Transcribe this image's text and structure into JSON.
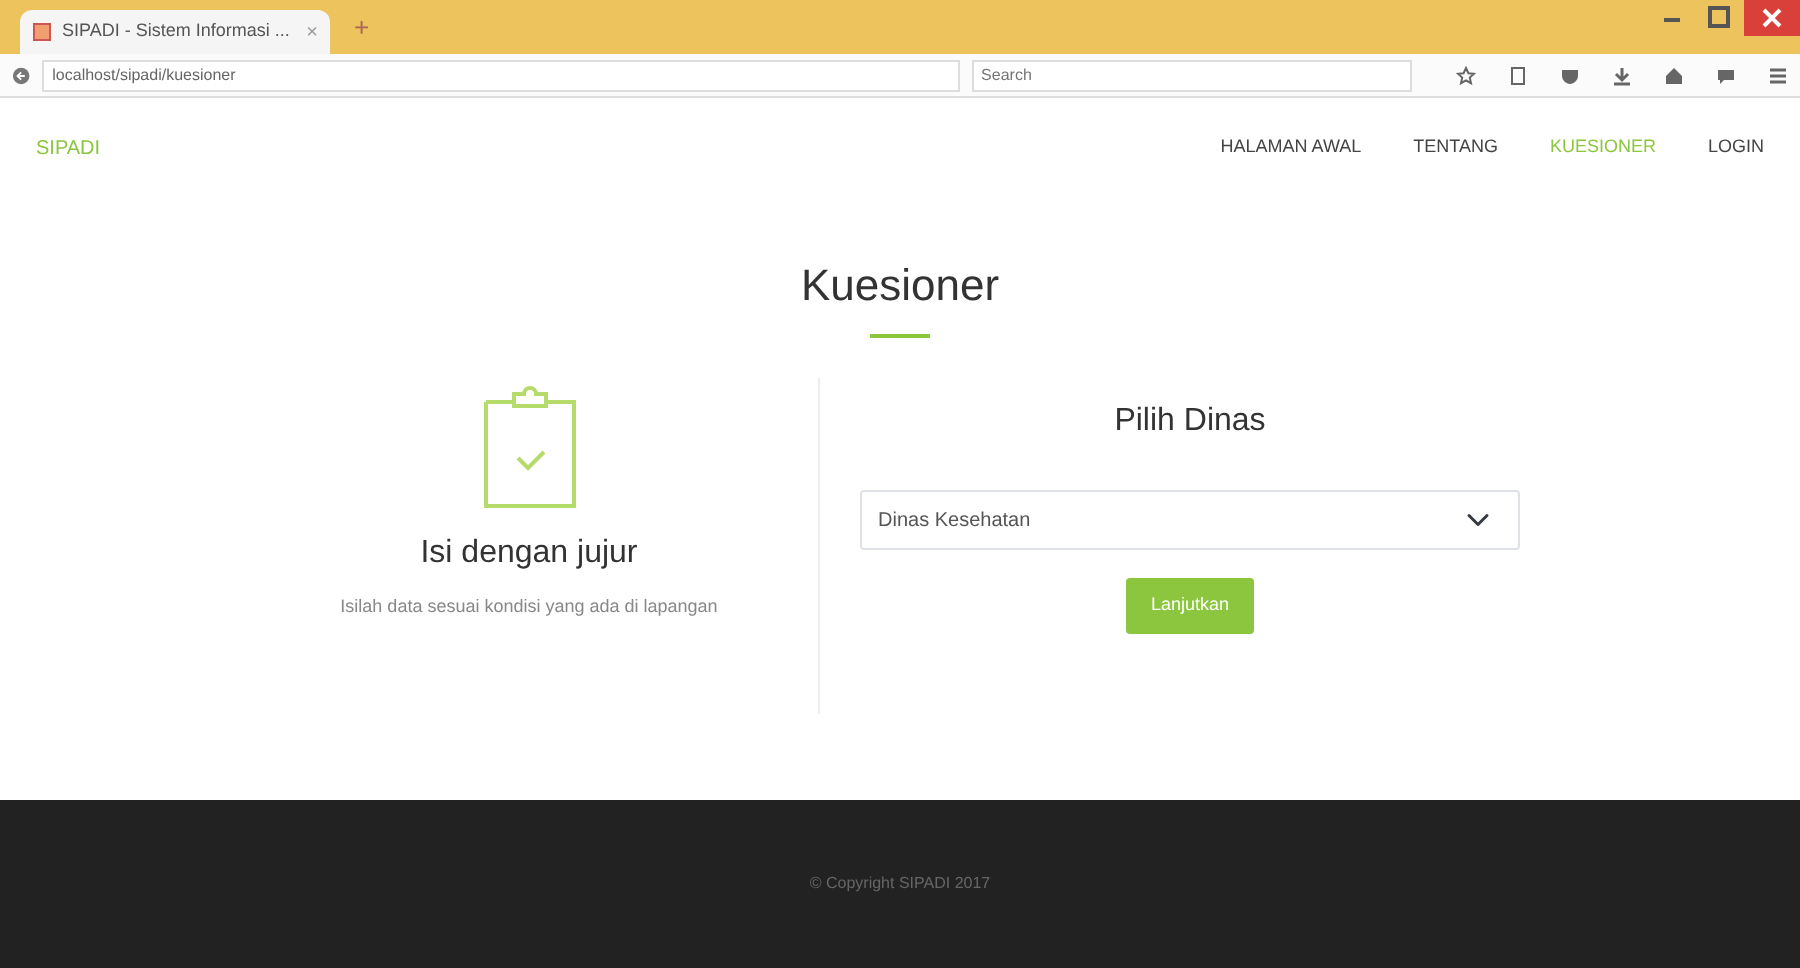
{
  "browser": {
    "tab_title": "SIPADI - Sistem Informasi ...",
    "tab_close": "×",
    "new_tab": "+",
    "url": "localhost/sipadi/kuesioner",
    "search_placeholder": "Search"
  },
  "navbar": {
    "brand": "SIPADI",
    "items": [
      {
        "label": "HALAMAN AWAL",
        "selected": false
      },
      {
        "label": "TENTANG",
        "selected": false
      },
      {
        "label": "KUESIONER",
        "selected": true
      },
      {
        "label": "LOGIN",
        "selected": false
      }
    ]
  },
  "page": {
    "title": "Kuesioner",
    "left": {
      "heading": "Isi dengan jujur",
      "text": "Isilah data sesuai kondisi yang ada di lapangan"
    },
    "right": {
      "heading": "Pilih Dinas",
      "select_value": "Dinas Kesehatan",
      "button": "Lanjutkan"
    }
  },
  "footer": {
    "text": "© Copyright SIPADI 2017"
  }
}
